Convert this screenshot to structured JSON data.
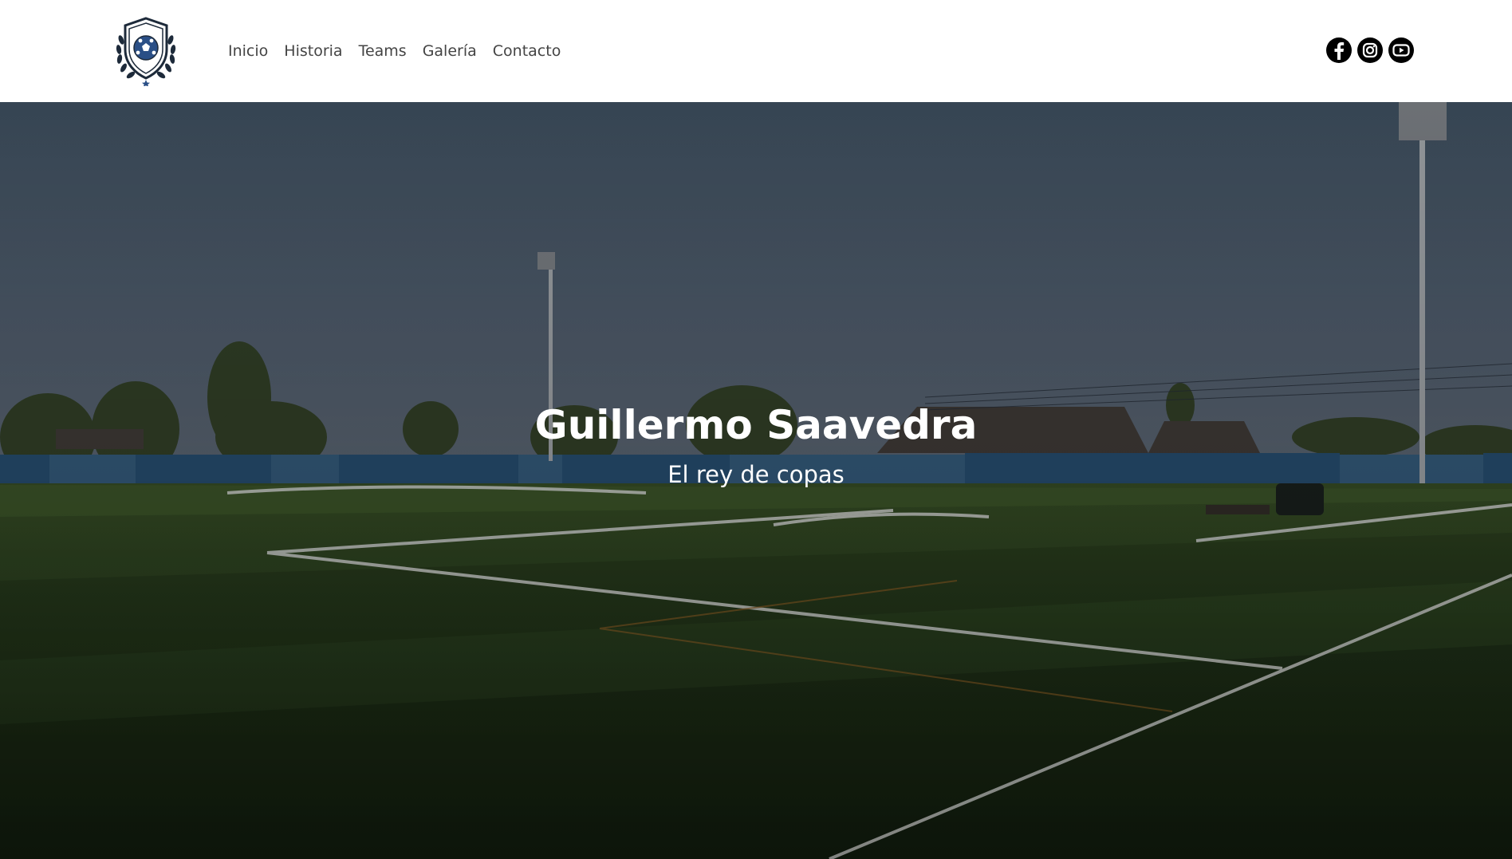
{
  "header": {
    "nav": [
      {
        "label": "Inicio"
      },
      {
        "label": "Historia"
      },
      {
        "label": "Teams"
      },
      {
        "label": "Galería"
      },
      {
        "label": "Contacto"
      }
    ],
    "social": [
      {
        "icon": "facebook-icon"
      },
      {
        "icon": "instagram-icon"
      },
      {
        "icon": "youtube-icon"
      }
    ]
  },
  "hero": {
    "title": "Guillermo Saavedra",
    "subtitle": "El rey de copas"
  },
  "colors": {
    "nav_text": "#444444",
    "logo_blue": "#2a4f86",
    "hero_text": "#ffffff"
  }
}
